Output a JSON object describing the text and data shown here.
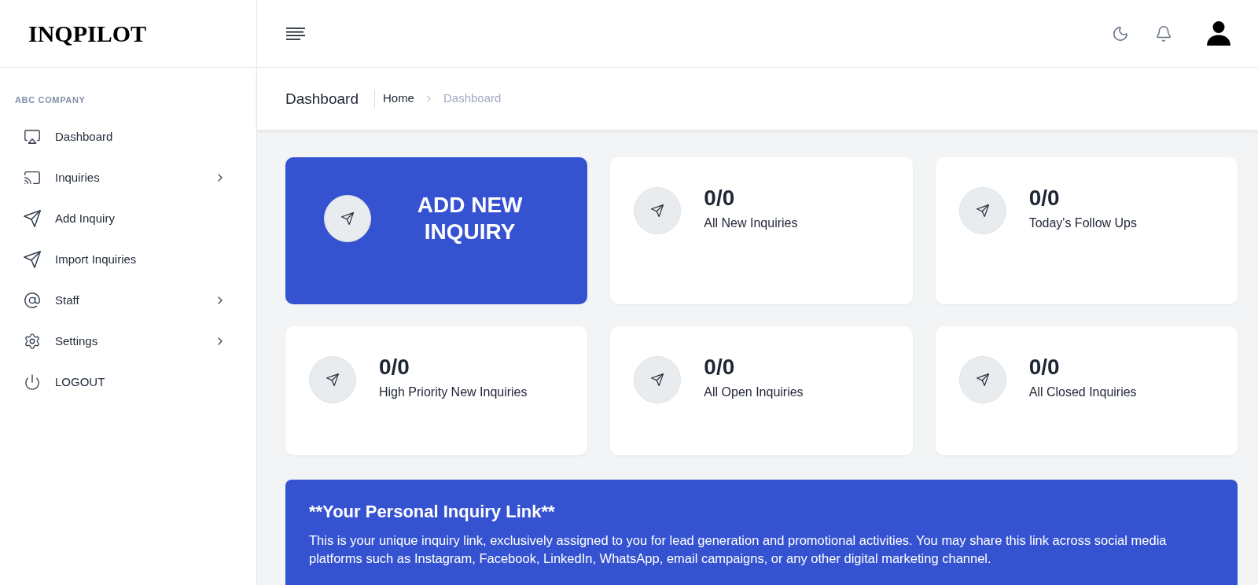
{
  "logo": "INQPILOT",
  "sidebar": {
    "section_label": "ABC COMPANY",
    "items": [
      {
        "label": "Dashboard",
        "expandable": false
      },
      {
        "label": "Inquiries",
        "expandable": true
      },
      {
        "label": "Add Inquiry",
        "expandable": false
      },
      {
        "label": "Import Inquiries",
        "expandable": false
      },
      {
        "label": "Staff",
        "expandable": true
      },
      {
        "label": "Settings",
        "expandable": true
      },
      {
        "label": "LOGOUT",
        "expandable": false
      }
    ]
  },
  "page_header": {
    "title": "Dashboard",
    "breadcrumb": [
      {
        "label": "Home",
        "current": false
      },
      {
        "label": "Dashboard",
        "current": true
      }
    ]
  },
  "cards": [
    {
      "kind": "action",
      "label": "ADD NEW INQUIRY"
    },
    {
      "kind": "stat",
      "value": "0/0",
      "label": "All New Inquiries"
    },
    {
      "kind": "stat",
      "value": "0/0",
      "label": "Today's Follow Ups"
    },
    {
      "kind": "stat",
      "value": "0/0",
      "label": "High Priority New Inquiries"
    },
    {
      "kind": "stat",
      "value": "0/0",
      "label": "All Open Inquiries"
    },
    {
      "kind": "stat",
      "value": "0/0",
      "label": "All Closed Inquiries"
    }
  ],
  "link_panel": {
    "title": "**Your Personal Inquiry Link**",
    "text": "This is your unique inquiry link, exclusively assigned to you for lead generation and promotional activities. You may share this link across social media platforms such as Instagram, Facebook, LinkedIn, WhatsApp, email campaigns, or any other digital marketing channel."
  }
}
